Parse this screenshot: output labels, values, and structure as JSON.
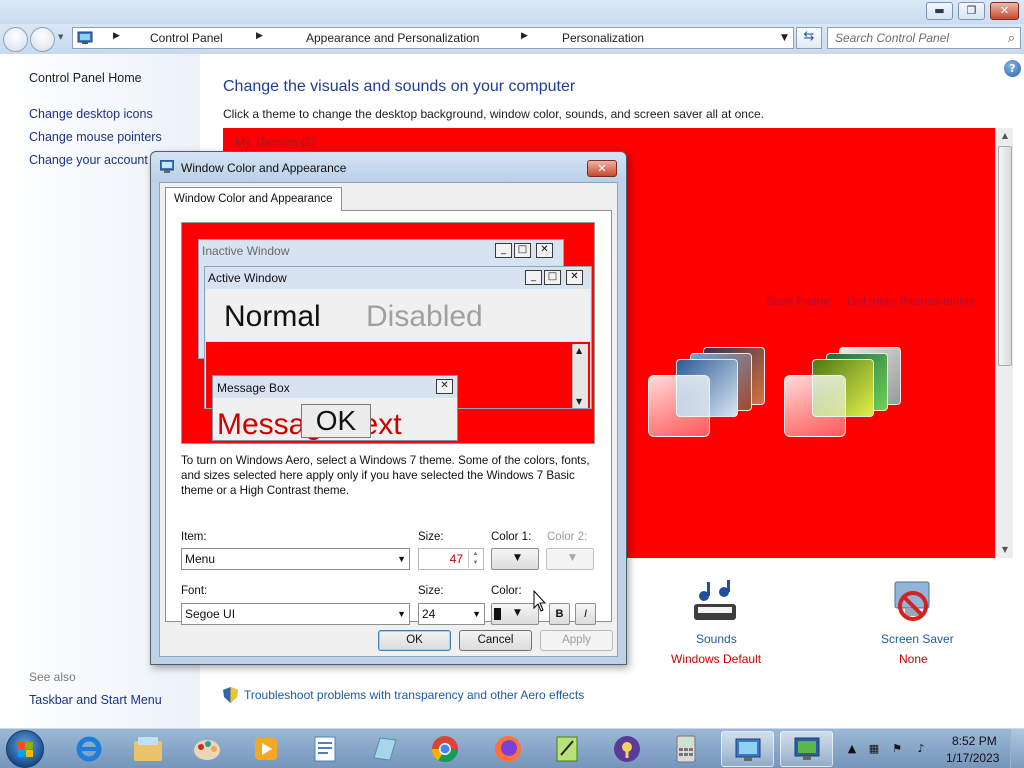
{
  "window": {
    "minimize_glyph": "▬",
    "maximize_glyph": "❐",
    "close_glyph": "✕"
  },
  "address": {
    "crumbs": [
      "Control Panel",
      "Appearance and Personalization",
      "Personalization"
    ],
    "search_placeholder": "Search Control Panel"
  },
  "sidebar": {
    "home": "Control Panel Home",
    "links": [
      "Change desktop icons",
      "Change mouse pointers",
      "Change your account p"
    ],
    "see_also": "See also",
    "see_also_links": [
      "Taskbar and Start Menu"
    ]
  },
  "main": {
    "heading": "Change the visuals and sounds on your computer",
    "subheading": "Click a theme to change the desktop background, window color, sounds, and screen saver all at once.",
    "my_themes": "My Themes (2)",
    "save_theme": "Save theme",
    "get_more_themes": "Get more themes online",
    "theme_panel_color": "#ff0000",
    "bottom_items": [
      {
        "label": "Sounds",
        "value": "Windows Default",
        "icon": "music-icon"
      },
      {
        "label": "Screen Saver",
        "value": "None",
        "icon": "no-screensaver-icon"
      }
    ],
    "aero_link": "Troubleshoot problems with transparency and other Aero effects"
  },
  "dialog": {
    "title": "Window Color and Appearance",
    "tab": "Window Color and Appearance",
    "preview": {
      "inactive_title": "Inactive Window",
      "active_title": "Active Window",
      "normal": "Normal",
      "disabled": "Disabled",
      "msgbox_title": "Message Box",
      "message_text": "Message Text",
      "ok": "OK"
    },
    "note": "To turn on Windows Aero, select a Windows 7 theme.  Some of the colors, fonts, and sizes selected here apply only if you have selected the Windows 7 Basic theme or a High Contrast theme.",
    "item_label": "Item:",
    "item_value": "Menu",
    "size_label": "Size:",
    "item_size": "47",
    "color1_label": "Color 1:",
    "color2_label": "Color 2:",
    "font_label": "Font:",
    "font_value": "Segoe UI",
    "font_size_label": "Size:",
    "font_size": "24",
    "color_label": "Color:",
    "bold": "B",
    "italic": "I",
    "ok": "OK",
    "cancel": "Cancel",
    "apply": "Apply"
  },
  "taskbar": {
    "time": "8:52 PM",
    "date": "1/17/2023",
    "apps": [
      "internet-explorer-icon",
      "file-explorer-icon",
      "paint-icon",
      "media-player-icon",
      "wordpad-icon",
      "notepad-icon",
      "chrome-icon",
      "firefox-icon",
      "notepad-plus-plus-icon",
      "keepass-icon",
      "calculator-icon",
      "control-panel-icon",
      "personalization-icon"
    ]
  }
}
